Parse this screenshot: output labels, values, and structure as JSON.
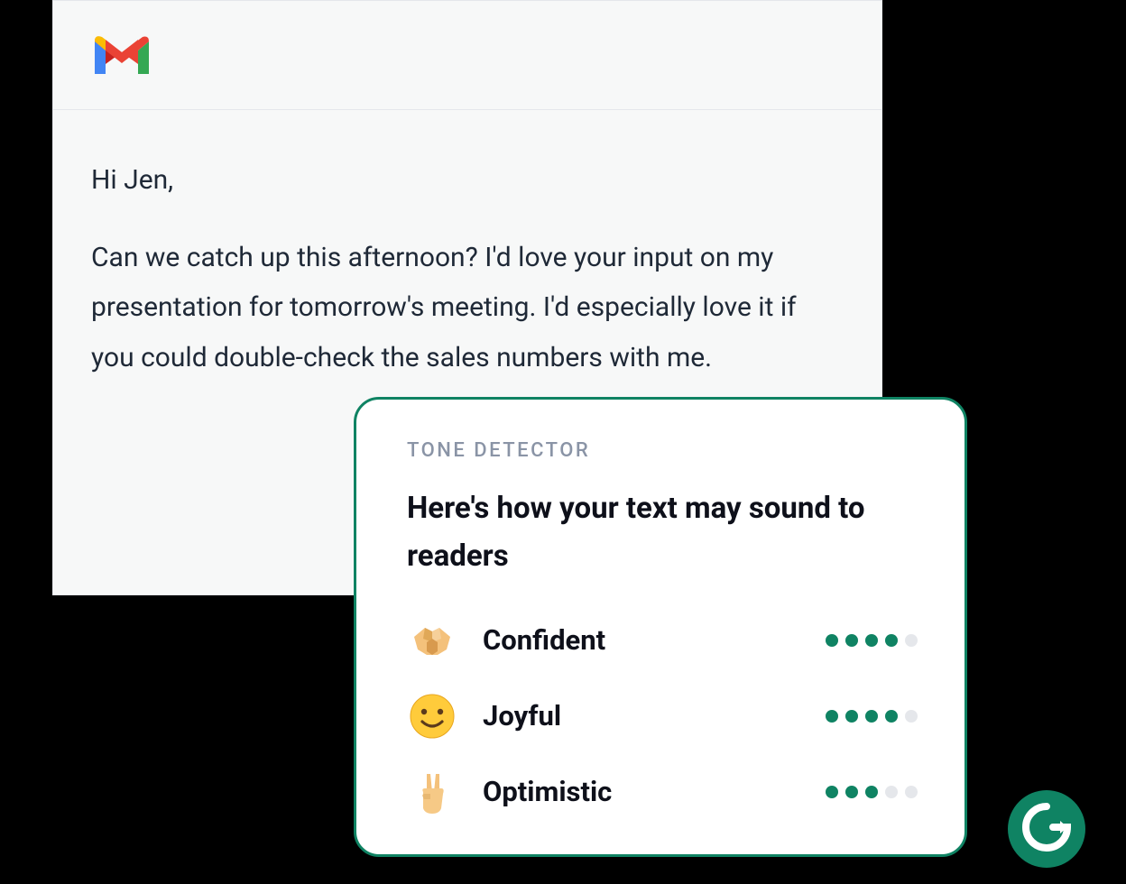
{
  "email": {
    "greeting": "Hi Jen,",
    "paragraph": "Can we catch up this afternoon? I'd love your input on my presentation for tomorrow's meeting. I'd especially love it if you could double-check the sales numbers with me."
  },
  "tone": {
    "label": "TONE DETECTOR",
    "title": "Here's how your text may sound to readers",
    "items": [
      {
        "emoji": "handshake",
        "name": "Confident",
        "score": 4,
        "max": 5
      },
      {
        "emoji": "smile",
        "name": "Joyful",
        "score": 4,
        "max": 5
      },
      {
        "emoji": "victory",
        "name": "Optimistic",
        "score": 3,
        "max": 5
      }
    ]
  },
  "colors": {
    "accent": "#0f8363"
  }
}
